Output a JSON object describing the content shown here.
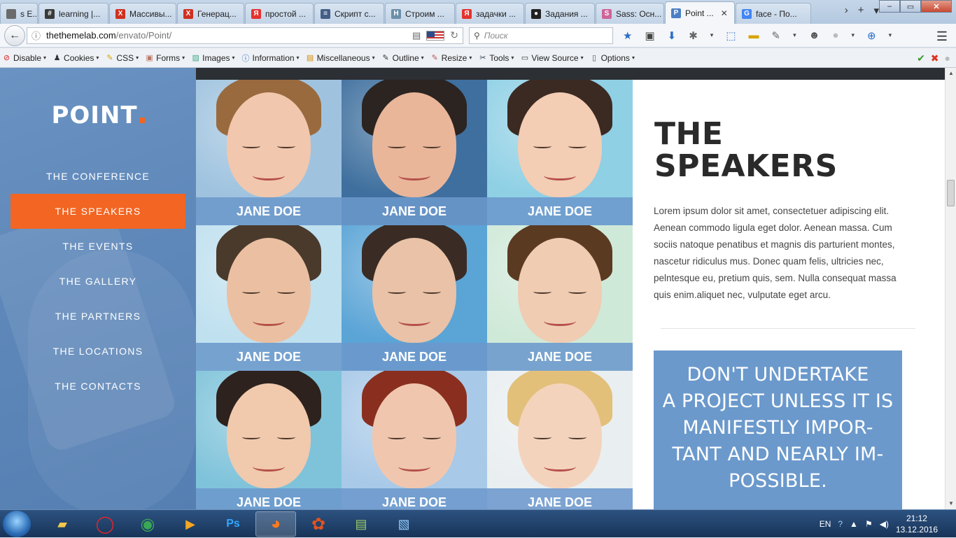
{
  "browser": {
    "tabs": [
      {
        "label": "s E...",
        "icon_color": "#6b6b6b",
        "glyph": "",
        "width": 54
      },
      {
        "label": "learning |...",
        "icon_color": "#3b3b3b",
        "glyph": "#",
        "width": 100
      },
      {
        "label": "Массивы...",
        "icon_color": "#d03020",
        "glyph": "Х",
        "width": 96
      },
      {
        "label": "Генерац...",
        "icon_color": "#d03020",
        "glyph": "Х",
        "width": 96
      },
      {
        "label": "простой ...",
        "icon_color": "#e5322d",
        "glyph": "Я",
        "width": 98
      },
      {
        "label": "Скрипт с...",
        "icon_color": "#445f86",
        "glyph": "≡",
        "width": 100
      },
      {
        "label": "Строим ...",
        "icon_color": "#6b8fa8",
        "glyph": "H",
        "width": 100
      },
      {
        "label": "задачки ...",
        "icon_color": "#e5322d",
        "glyph": "Я",
        "width": 98
      },
      {
        "label": "Задания ...",
        "icon_color": "#222222",
        "glyph": "●",
        "width": 100
      },
      {
        "label": "Sass: Осн...",
        "icon_color": "#cf649a",
        "glyph": "S",
        "width": 98
      },
      {
        "label": "Point ...",
        "icon_color": "#4b7fc4",
        "glyph": "P",
        "width": 100,
        "active": true
      },
      {
        "label": "face - По...",
        "icon_color": "#4285f4",
        "glyph": "G",
        "width": 108
      }
    ],
    "url_host": "thethemelab.com",
    "url_path": "/envato/Point/",
    "search_placeholder": "Поиск",
    "devbar": [
      "Disable",
      "Cookies",
      "CSS",
      "Forms",
      "Images",
      "Information",
      "Miscellaneous",
      "Outline",
      "Resize",
      "Tools",
      "View Source",
      "Options"
    ]
  },
  "site": {
    "logo": "POINT",
    "menu": [
      {
        "label": "THE CONFERENCE"
      },
      {
        "label": "THE SPEAKERS",
        "active": true
      },
      {
        "label": "THE EVENTS"
      },
      {
        "label": "THE GALLERY"
      },
      {
        "label": "THE PARTNERS"
      },
      {
        "label": "THE LOCATIONS"
      },
      {
        "label": "THE CONTACTS"
      }
    ],
    "speakers": [
      {
        "name": "JANE DOE",
        "bg": "#9fc3df",
        "skin": "#f1c7ae",
        "hair": "#9a6a3f"
      },
      {
        "name": "JANE DOE",
        "bg": "#3e6f9e",
        "skin": "#e9b69a",
        "hair": "#2b2421"
      },
      {
        "name": "JANE DOE",
        "bg": "#8fd0e5",
        "skin": "#f3cdb4",
        "hair": "#3b2a22"
      },
      {
        "name": "JANE DOE",
        "bg": "#bfe0ef",
        "skin": "#ebc0a2",
        "hair": "#4a3a2c"
      },
      {
        "name": "JANE DOE",
        "bg": "#5aa4d6",
        "skin": "#e9c2a7",
        "hair": "#3a2c24"
      },
      {
        "name": "JANE DOE",
        "bg": "#cfe9d8",
        "skin": "#f0ccb2",
        "hair": "#5b3a22"
      },
      {
        "name": "JANE DOE",
        "bg": "#7fc3da",
        "skin": "#f1c9ad",
        "hair": "#2d221d"
      },
      {
        "name": "JANE DOE",
        "bg": "#a8c9e8",
        "skin": "#f0c7ae",
        "hair": "#8a2f1f"
      },
      {
        "name": "JANE DOE",
        "bg": "#e9eef0",
        "skin": "#f4d3bd",
        "hair": "#e2c07a"
      }
    ],
    "title_line1": "THE",
    "title_line2": "SPEAKERS",
    "lorem": "Lorem ipsum dolor sit amet, consectetuer adipiscing elit. Aenean commodo ligula eget dolor. Aenean massa. Cum sociis natoque penatibus et magnis dis parturient montes, nascetur ridiculus mus. Donec quam felis, ultricies nec, pelntesque eu, pretium quis, sem. Nulla consequat massa quis enim.aliquet nec, vulputate eget arcu.",
    "quote_lines": [
      "DON'T UNDERTAKE",
      "A PROJECT UNLESS IT IS",
      "MANIFESTLY IMPOR-",
      "TANT AND NEARLY IM-",
      "POSSIBLE."
    ],
    "accent": "#f26522",
    "quote_bg": "#6b99cc"
  },
  "taskbar": {
    "lang": "EN",
    "time": "21:12",
    "date": "13.12.2016"
  }
}
